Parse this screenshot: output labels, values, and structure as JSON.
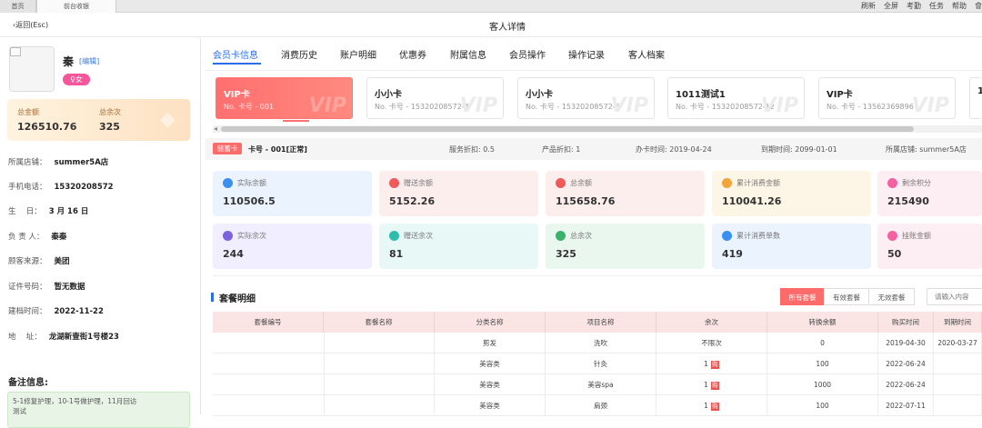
{
  "topbar": {
    "tabs": [
      "首页",
      "前台收银"
    ],
    "actions": [
      "刷新",
      "全屏",
      "考勤",
      "任务",
      "帮助",
      "會"
    ]
  },
  "header": {
    "back_label": "返回(Esc)",
    "title": "客人详情"
  },
  "customer": {
    "name": "秦",
    "edit_label": "[编辑]",
    "gender": "女",
    "gender_color": "#f7569a",
    "summary": {
      "total_amount_label": "总金额",
      "total_amount": "126510.76",
      "total_times_label": "总余次",
      "total_times": "325"
    },
    "info": [
      {
        "label": "所属店铺：",
        "value": "summer5A店"
      },
      {
        "label": "手机电话：",
        "value": "15320208572"
      },
      {
        "label": "生　 日：",
        "value": "3 月 16 日"
      },
      {
        "label": "负 责 人：",
        "value": "秦秦"
      },
      {
        "label": "顾客来源：",
        "value": "美团"
      },
      {
        "label": "证件号码：",
        "value": "暂无数据"
      },
      {
        "label": "建档时间：",
        "value": "2022-11-22"
      },
      {
        "label": "地　 址：",
        "value": "龙湖新壹街1号楼23"
      }
    ],
    "remark_title": "备注信息:",
    "remark_text": "5-1修复护理，10-1号做护理，11月回访",
    "remark_text2": "测试"
  },
  "tabs": [
    "会员卡信息",
    "消费历史",
    "账户明细",
    "优惠券",
    "附属信息",
    "会员操作",
    "操作记录",
    "客人档案"
  ],
  "cards": [
    {
      "name": "VIP卡",
      "no": "No. 卡号 - 001",
      "watermark": "VIP"
    },
    {
      "name": "小小卡",
      "no": "No. 卡号 - 15320208572-4",
      "watermark": "VIP"
    },
    {
      "name": "小小卡",
      "no": "No. 卡号 - 15320208572-6",
      "watermark": "VIP"
    },
    {
      "name": "1011测试1",
      "no": "No. 卡号 - 15320208572-12",
      "watermark": "VIP"
    },
    {
      "name": "VIP卡",
      "no": "No. 卡号 - 13562369896",
      "watermark": "VIP"
    },
    {
      "name": "1",
      "no": "",
      "watermark": ""
    }
  ],
  "card_info": {
    "tag": "储蓄卡",
    "card_no": "卡号 - 001[正常]",
    "service_discount": "服务折扣:  0.5",
    "product_discount": "产品折扣:  1",
    "open_date": "办卡时间:  2019-04-24",
    "expire_date": "到期时间:  2099-01-01",
    "store": "所属店铺:  summer5A店"
  },
  "stats": [
    {
      "label": "实际余额",
      "value": "110506.5",
      "bg": "#eaf3fe",
      "icon": "#3b8ff0",
      "icon_name": "coin-icon"
    },
    {
      "label": "赠送余额",
      "value": "5152.26",
      "bg": "#fdeeee",
      "icon": "#ef5b5b",
      "icon_name": "gift-bag-icon"
    },
    {
      "label": "总余额",
      "value": "115658.76",
      "bg": "#fdeeee",
      "icon": "#ef5b5b",
      "icon_name": "wallet-icon"
    },
    {
      "label": "累计消费金额",
      "value": "110041.26",
      "bg": "#fdf5e6",
      "icon": "#f2a53b",
      "icon_name": "medal-icon"
    },
    {
      "label": "剩余积分",
      "value": "215490",
      "bg": "#fdeef4",
      "icon": "#f262a2",
      "icon_name": "points-icon"
    },
    {
      "label": "实际余次",
      "value": "244",
      "bg": "#f1efff",
      "icon": "#7b62e0",
      "icon_name": "document-icon"
    },
    {
      "label": "赠送余次",
      "value": "81",
      "bg": "#e8f8f6",
      "icon": "#2dbdaa",
      "icon_name": "gift-box-icon"
    },
    {
      "label": "总余次",
      "value": "325",
      "bg": "#eaf7ee",
      "icon": "#39b369",
      "icon_name": "wallet-green-icon"
    },
    {
      "label": "累计消费单数",
      "value": "419",
      "bg": "#eaf3fe",
      "icon": "#3b8ff0",
      "icon_name": "order-icon"
    },
    {
      "label": "挂账金额",
      "value": "50",
      "bg": "#fdeef4",
      "icon": "#f262a2",
      "icon_name": "tag-icon"
    }
  ],
  "package": {
    "title": "套餐明细",
    "filters": [
      "所有套餐",
      "有效套餐",
      "无效套餐"
    ],
    "search_placeholder": "请输入内容",
    "columns": [
      "套餐编号",
      "套餐名称",
      "分类名称",
      "项目名称",
      "余次",
      "转换余额",
      "购买时间",
      "到期时间"
    ],
    "rows": [
      {
        "category": "剪发",
        "item": "洗吹",
        "times": "不限次",
        "gou": false,
        "balance": "0",
        "buy": "2019-04-30",
        "expire": "2020-03-27"
      },
      {
        "category": "美容类",
        "item": "针灸",
        "times": "1",
        "gou": true,
        "balance": "100",
        "buy": "2022-06-24",
        "expire": ""
      },
      {
        "category": "美容类",
        "item": "美容spa",
        "times": "1",
        "gou": true,
        "balance": "1000",
        "buy": "2022-06-24",
        "expire": ""
      },
      {
        "category": "美容类",
        "item": "肩颈",
        "times": "1",
        "gou": true,
        "balance": "100",
        "buy": "2022-07-11",
        "expire": ""
      }
    ],
    "gou_label": "购"
  }
}
